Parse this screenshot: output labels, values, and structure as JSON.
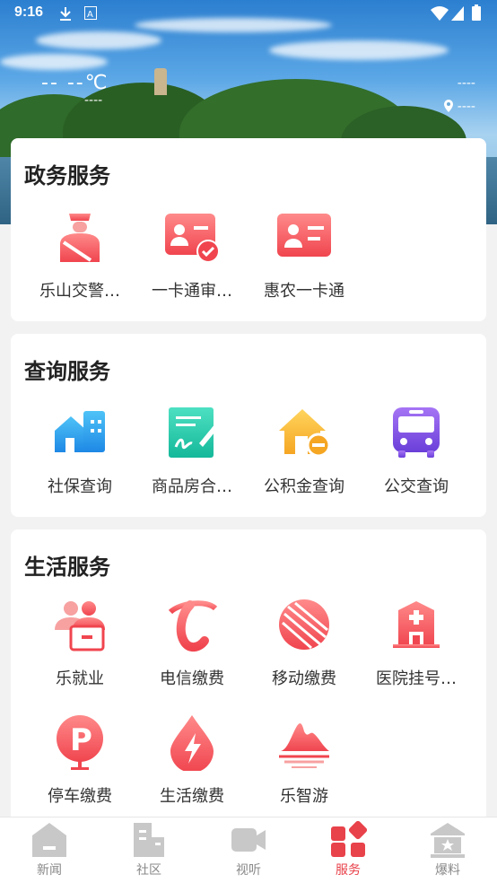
{
  "status_bar": {
    "time": "9:16"
  },
  "weather": {
    "temp": "-- --℃",
    "desc": "----",
    "right_top": "----",
    "right_bottom": "----"
  },
  "sections": [
    {
      "title": "政务服务",
      "items": [
        {
          "label": "乐山交警…",
          "icon": "traffic-police-icon"
        },
        {
          "label": "一卡通审…",
          "icon": "card-approval-icon"
        },
        {
          "label": "惠农一卡通",
          "icon": "id-card-icon"
        }
      ]
    },
    {
      "title": "查询服务",
      "items": [
        {
          "label": "社保查询",
          "icon": "social-security-icon"
        },
        {
          "label": "商品房合…",
          "icon": "contract-icon"
        },
        {
          "label": "公积金查询",
          "icon": "housing-fund-icon"
        },
        {
          "label": "公交查询",
          "icon": "bus-icon"
        }
      ]
    },
    {
      "title": "生活服务",
      "items": [
        {
          "label": "乐就业",
          "icon": "employment-icon"
        },
        {
          "label": "电信缴费",
          "icon": "telecom-icon"
        },
        {
          "label": "移动缴费",
          "icon": "mobile-icon"
        },
        {
          "label": "医院挂号…",
          "icon": "hospital-icon"
        },
        {
          "label": "停车缴费",
          "icon": "parking-icon"
        },
        {
          "label": "生活缴费",
          "icon": "utility-icon"
        },
        {
          "label": "乐智游",
          "icon": "tourism-icon"
        }
      ]
    }
  ],
  "bottom_nav": [
    {
      "label": "新闻",
      "icon": "news-icon",
      "active": false
    },
    {
      "label": "社区",
      "icon": "community-icon",
      "active": false
    },
    {
      "label": "视听",
      "icon": "video-icon",
      "active": false
    },
    {
      "label": "服务",
      "icon": "service-icon",
      "active": true
    },
    {
      "label": "爆料",
      "icon": "report-icon",
      "active": false
    }
  ],
  "colors": {
    "accent": "#e8424a",
    "icon_red": "#f0545a",
    "icon_blue": "#1e88e5",
    "icon_green": "#17c3a7",
    "icon_orange": "#f5a623",
    "icon_purple": "#7b4fe0"
  }
}
